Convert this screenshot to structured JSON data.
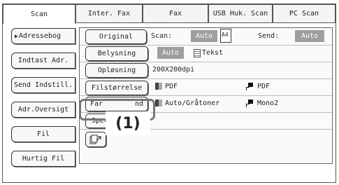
{
  "tabs": [
    {
      "label": "Scan",
      "active": true
    },
    {
      "label": "Inter. Fax",
      "active": false
    },
    {
      "label": "Fax",
      "active": false
    },
    {
      "label": "USB Huk. Scan",
      "active": false
    },
    {
      "label": "PC Scan",
      "active": false
    }
  ],
  "sidebar": {
    "items": [
      {
        "label": "Adressebog",
        "arrow": "▶"
      },
      {
        "label": "Indtast Adr."
      },
      {
        "label": "Send Indstill."
      },
      {
        "label": "Adr.Oversigt"
      },
      {
        "label": "Fil"
      },
      {
        "label": "Hurtig Fil"
      }
    ]
  },
  "settings": {
    "original": {
      "button": "Original",
      "scan_label": "Scan:",
      "scan_value": "Auto",
      "paper": "A4",
      "send_label": "Send:",
      "send_value": "Auto"
    },
    "exposure": {
      "button": "Belysning",
      "mode": "Auto",
      "type": "Tekst"
    },
    "resolution": {
      "button": "Opløsning",
      "value": "200X200dpi"
    },
    "file_format": {
      "button": "Filstørrelse",
      "color_format": "PDF",
      "mono_format": "PDF"
    },
    "color_mode": {
      "button_left": "Far",
      "button_right": "nd",
      "color_value": "Auto/Gråtoner",
      "mono_value": "Mono2"
    },
    "special": {
      "button": "Specialfunk."
    }
  },
  "callout": {
    "label": "(1)"
  },
  "colors": {
    "highlight": "#777777",
    "grey_indicator": "#9e9e9e"
  }
}
